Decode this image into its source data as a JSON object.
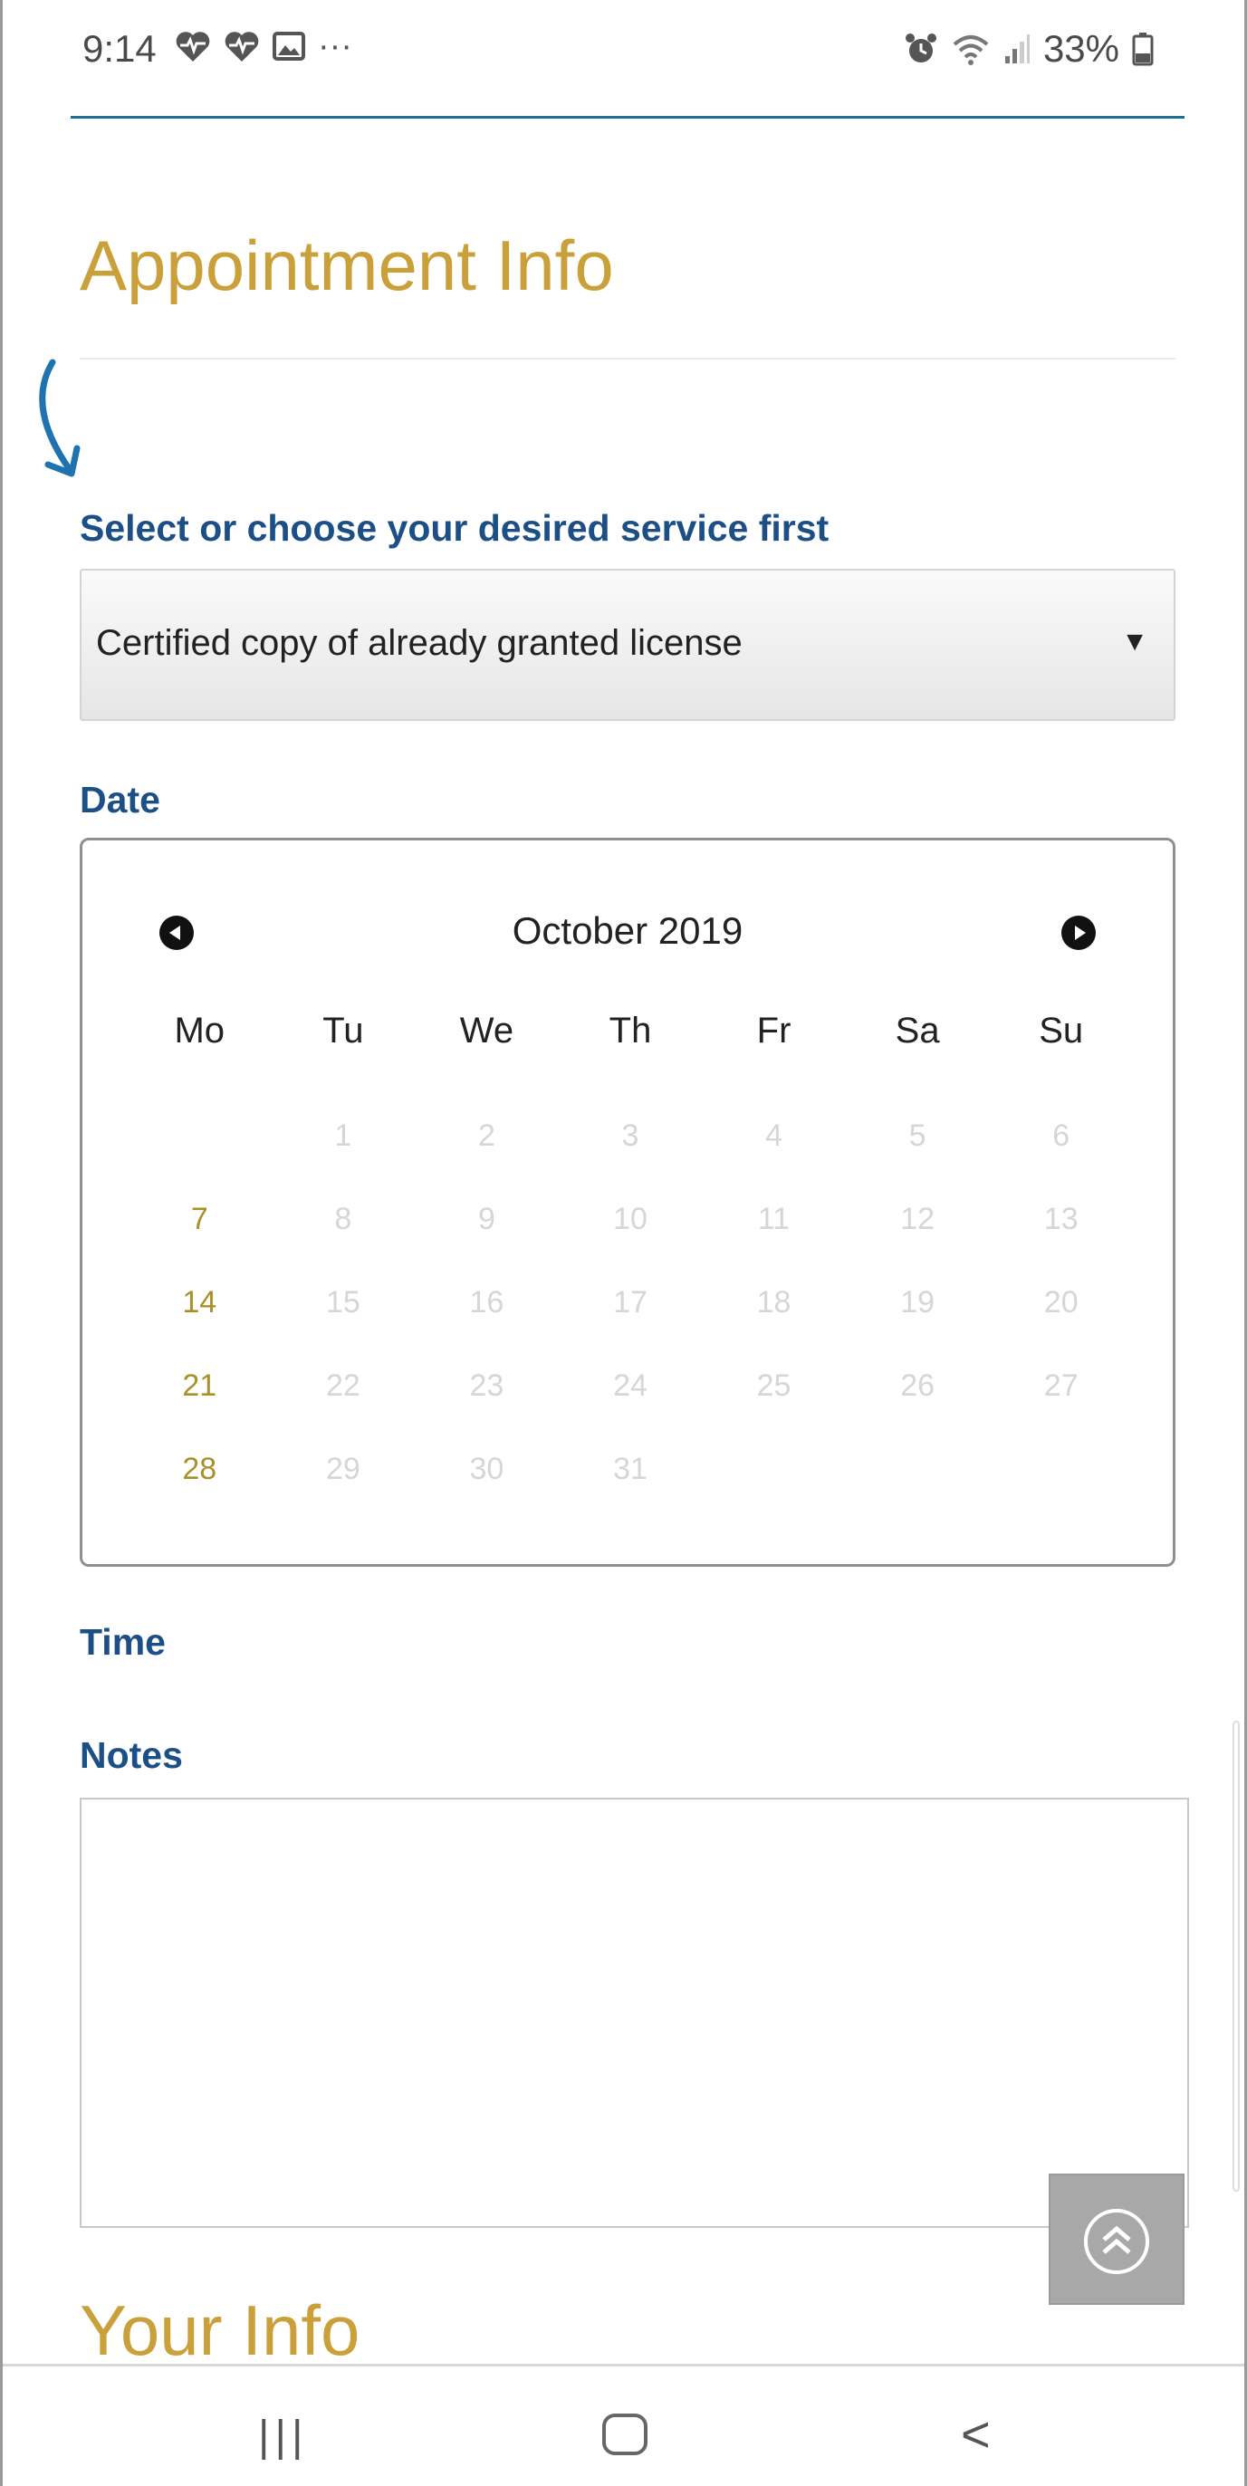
{
  "status_bar": {
    "time": "9:14",
    "left_icons": [
      "heart-pulse-icon",
      "heart-pulse-icon",
      "image-icon",
      "more-dots-icon"
    ],
    "more": "···",
    "right_icons": [
      "alarm-icon",
      "wifi-icon",
      "signal-icon"
    ],
    "battery_percent": "33%"
  },
  "appointment": {
    "title": "Appointment Info",
    "service_label": "Select or choose your desired service first",
    "service_value": "Certified copy of already granted license",
    "date_label": "Date",
    "time_label": "Time",
    "notes_label": "Notes"
  },
  "calendar": {
    "month": "October 2019",
    "weekdays": [
      "Mo",
      "Tu",
      "We",
      "Th",
      "Fr",
      "Sa",
      "Su"
    ],
    "first_weekday_offset": 1,
    "days": [
      "1",
      "2",
      "3",
      "4",
      "5",
      "6",
      "7",
      "8",
      "9",
      "10",
      "11",
      "12",
      "13",
      "14",
      "15",
      "16",
      "17",
      "18",
      "19",
      "20",
      "21",
      "22",
      "23",
      "24",
      "25",
      "26",
      "27",
      "28",
      "29",
      "30",
      "31"
    ],
    "available_days": [
      "7",
      "14",
      "21",
      "28"
    ],
    "colors": {
      "available": "#a8912a",
      "unavailable": "#d6d6d6"
    }
  },
  "your_info": {
    "title": "Your Info"
  },
  "scroll_top_button": {
    "icon": "double-chevron-up-icon"
  },
  "nav_bar": {
    "recents": "|||",
    "back": "<"
  },
  "colors": {
    "heading": "#c9a03a",
    "label": "#1b4f86",
    "accent_rule": "#1f6f92"
  }
}
